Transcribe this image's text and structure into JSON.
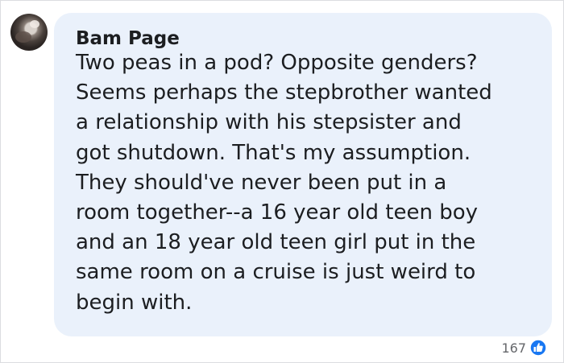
{
  "comment": {
    "author": "Bam Page",
    "text_lines": [
      "Two peas in a pod? Opposite genders?",
      "Seems perhaps the stepbrother wanted",
      "a relationship with his stepsister and",
      "got shutdown. That's my assumption.",
      "They should've never been put in a",
      "room together--a 16 year old teen boy",
      "and an 18 year old teen girl put in the",
      "same room on a cruise is just weird to",
      "begin with."
    ],
    "reaction_count": "167",
    "reaction_icon": "like-icon",
    "bubble_color": "#eaf1fb",
    "like_color": "#1877f2"
  }
}
